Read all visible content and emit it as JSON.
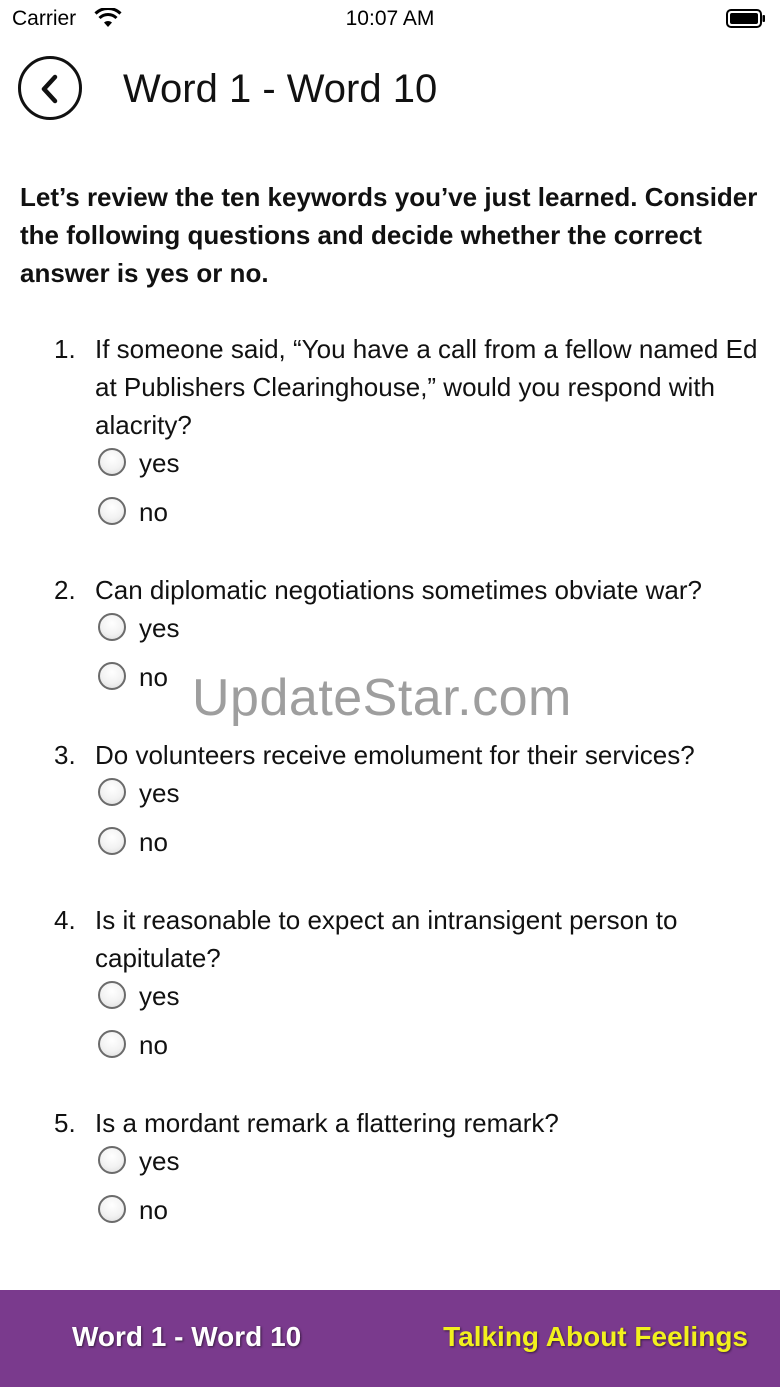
{
  "status_bar": {
    "carrier": "Carrier",
    "time": "10:07 AM",
    "wifi_icon": "wifi-icon",
    "battery_icon": "battery-icon"
  },
  "header": {
    "back_icon": "chevron-left-icon",
    "title": "Word 1 - Word 10"
  },
  "intro": "Let’s review the ten keywords you’ve just learned. Consider the following questions and decide whether the correct answer is yes or no.",
  "questions": [
    {
      "number": "1.",
      "text": "If someone said, “You have a call from a fellow named Ed at Publishers Clearinghouse,” would you respond with alacrity?",
      "options": [
        "yes",
        "no"
      ]
    },
    {
      "number": "2.",
      "text": "Can diplomatic negotiations sometimes obviate war?",
      "options": [
        "yes",
        "no"
      ]
    },
    {
      "number": "3.",
      "text": "Do volunteers receive emolument for their services?",
      "options": [
        "yes",
        "no"
      ]
    },
    {
      "number": "4.",
      "text": "Is it reasonable to expect an intransigent person to capitulate?",
      "options": [
        "yes",
        "no"
      ]
    },
    {
      "number": "5.",
      "text": "Is a mordant remark a flattering remark?",
      "options": [
        "yes",
        "no"
      ]
    }
  ],
  "watermark": "UpdateStar.com",
  "footer": {
    "left_label": "Word 1 - Word 10",
    "right_label": "Talking About Feelings",
    "background": "#7a3a8d",
    "right_color": "#f2f11d"
  }
}
